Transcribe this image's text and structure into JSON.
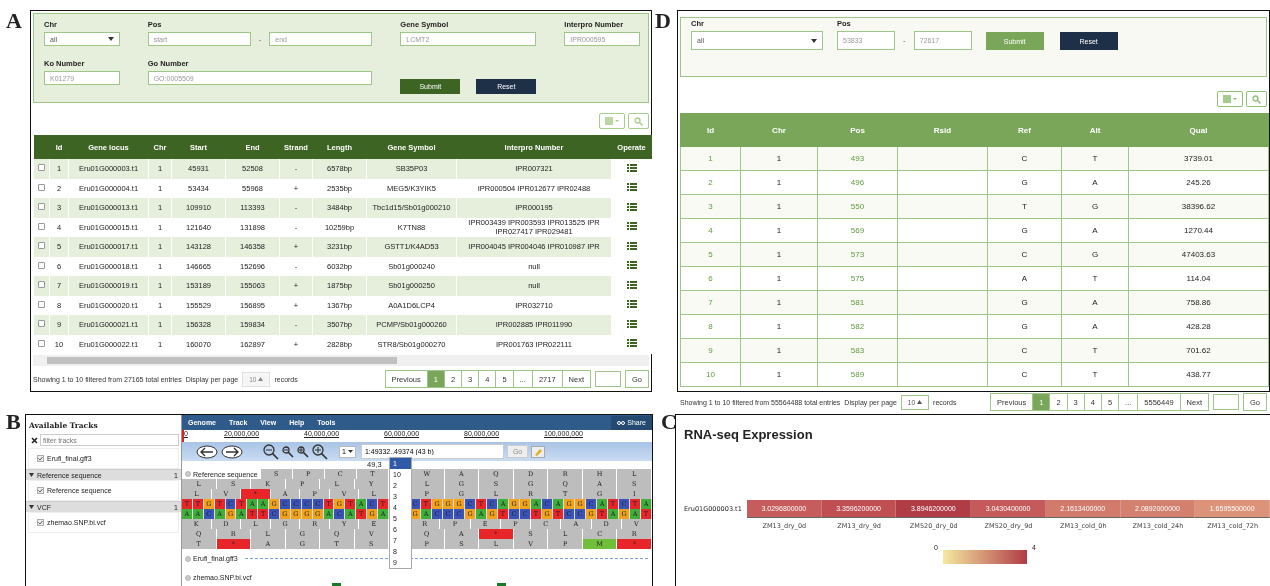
{
  "panel_a": {
    "letter": "A",
    "filters": [
      {
        "label": "Chr",
        "kind": "select",
        "value": "all"
      },
      {
        "label": "Pos",
        "kind": "range",
        "placeholder": "start",
        "placeholder_end": "end",
        "separator": "-"
      },
      {
        "label": "Gene Symbol",
        "kind": "text",
        "placeholder": "LCMT2"
      },
      {
        "label": "Interpro Number",
        "kind": "text",
        "placeholder": "IPR000595"
      },
      {
        "label": "Ko Number",
        "kind": "text",
        "placeholder": "K01279"
      },
      {
        "label": "Go Number",
        "kind": "text",
        "placeholder": "GO:0005509"
      }
    ],
    "submit": "Submit",
    "reset": "Reset",
    "columns": [
      "Id",
      "Gene locus",
      "Chr",
      "Start",
      "End",
      "Strand",
      "Length",
      "Gene Symbol",
      "Interpro Number",
      "Operate"
    ],
    "rows": [
      {
        "checked": false,
        "cells": [
          "1",
          "Eru01G000003.t1",
          "1",
          "45931",
          "52508",
          "-",
          "6578bp",
          "SB35P03",
          "IPR007321"
        ]
      },
      {
        "checked": false,
        "cells": [
          "2",
          "Eru01G000004.t1",
          "1",
          "53434",
          "55968",
          "+",
          "2535bp",
          "MEG5/K3YIK5",
          "IPR000504 IPR012677 IPR02488"
        ]
      },
      {
        "checked": false,
        "cells": [
          "3",
          "Eru01G000013.t1",
          "1",
          "109910",
          "113393",
          "-",
          "3484bp",
          "Tbc1d15/Sb01g000210",
          "IPR000195"
        ]
      },
      {
        "checked": false,
        "cells": [
          "4",
          "Eru01G000015.t1",
          "1",
          "121640",
          "131898",
          "-",
          "10259bp",
          "K7TN88",
          "IPR003439 IPR003593 IPR013525 IPR\nIPR027417 IPR029481"
        ]
      },
      {
        "checked": false,
        "cells": [
          "5",
          "Eru01G000017.t1",
          "1",
          "143128",
          "146358",
          "+",
          "3231bp",
          "GSTT1/K4AD53",
          "IPR004045 IPR004046 IPR010987 IPR"
        ]
      },
      {
        "checked": false,
        "cells": [
          "6",
          "Eru01G000018.t1",
          "1",
          "146665",
          "152696",
          "-",
          "6032bp",
          "Sb01g000240",
          "null"
        ]
      },
      {
        "checked": false,
        "cells": [
          "7",
          "Eru01G000019.t1",
          "1",
          "153189",
          "155063",
          "+",
          "1875bp",
          "Sb01g000250",
          "null"
        ]
      },
      {
        "checked": false,
        "cells": [
          "8",
          "Eru01G000020.t1",
          "1",
          "155529",
          "156895",
          "+",
          "1367bp",
          "A0A1D6LCP4",
          "IPR032710"
        ]
      },
      {
        "checked": false,
        "cells": [
          "9",
          "Eru01G000021.t1",
          "1",
          "156328",
          "159834",
          "-",
          "3507bp",
          "PCMP/Sb01g000260",
          "IPR002885 IPR011990"
        ]
      },
      {
        "checked": false,
        "cells": [
          "10",
          "Eru01G000022.t1",
          "1",
          "160070",
          "162897",
          "+",
          "2828bp",
          "STR8/Sb01g000270",
          "IPR001763 IPR022111"
        ]
      }
    ],
    "summary": "Showing 1 to 10 filtered from 27165 total entries",
    "per_page_label": "Display per page",
    "per_page": {
      "value": "10",
      "disabled": true
    },
    "records": "records",
    "previous": "Previous",
    "next": "Next",
    "go": "Go",
    "pages": [
      {
        "label": "1",
        "selected": true
      },
      {
        "label": "2",
        "selected": false
      },
      {
        "label": "3",
        "selected": false
      },
      {
        "label": "4",
        "selected": false
      },
      {
        "label": "5",
        "selected": false
      },
      {
        "label": "...",
        "selected": false
      },
      {
        "label": "2717",
        "selected": false
      }
    ]
  },
  "panel_d": {
    "letter": "D",
    "chr_label": "Chr",
    "chr_value": "all",
    "pos_label": "Pos",
    "placeholder_start": "53833",
    "placeholder_end": "72617",
    "separator": "-",
    "submit": "Submit",
    "reset": "Reset",
    "columns": [
      {
        "label": "Id",
        "link": true
      },
      {
        "label": "Chr"
      },
      {
        "label": "Pos",
        "link": true
      },
      {
        "label": "Rsid"
      },
      {
        "label": "Ref"
      },
      {
        "label": "Alt"
      },
      {
        "label": "Qual"
      }
    ],
    "rows": [
      [
        "1",
        "1",
        "493",
        "",
        "C",
        "T",
        "3739.01"
      ],
      [
        "2",
        "1",
        "496",
        "",
        "G",
        "A",
        "245.26"
      ],
      [
        "3",
        "1",
        "550",
        "",
        "T",
        "G",
        "38396.62"
      ],
      [
        "4",
        "1",
        "569",
        "",
        "G",
        "A",
        "1270.44"
      ],
      [
        "5",
        "1",
        "573",
        "",
        "C",
        "G",
        "47403.63"
      ],
      [
        "6",
        "1",
        "575",
        "",
        "A",
        "T",
        "114.04"
      ],
      [
        "7",
        "1",
        "581",
        "",
        "G",
        "A",
        "758.86"
      ],
      [
        "8",
        "1",
        "582",
        "",
        "G",
        "A",
        "428.28"
      ],
      [
        "9",
        "1",
        "583",
        "",
        "C",
        "T",
        "701.62"
      ],
      [
        "10",
        "1",
        "589",
        "",
        "C",
        "T",
        "438.77"
      ]
    ],
    "summary": "Showing 1 to 10 filtered from 55564488 total entries",
    "per_page_label": "Display per page",
    "per_page": {
      "value": "10",
      "disabled": false
    },
    "records": "records",
    "previous": "Previous",
    "next": "Next",
    "go": "Go",
    "pages": [
      {
        "label": "1",
        "selected": true
      },
      {
        "label": "2",
        "selected": false
      },
      {
        "label": "3",
        "selected": false
      },
      {
        "label": "4",
        "selected": false
      },
      {
        "label": "5",
        "selected": false
      },
      {
        "label": "...",
        "selected": false
      },
      {
        "label": "5556449",
        "selected": false
      }
    ]
  },
  "panel_b": {
    "letter": "B",
    "tracks_title": "Available Tracks",
    "filter": {
      "placeholder": "filter tracks"
    },
    "track_sections": [
      {
        "items": [
          {
            "label": "Erufi_final.gff3",
            "checked": true
          }
        ]
      },
      {
        "title": "Reference sequence",
        "count": "1",
        "expanded": true,
        "items": [
          {
            "label": "Reference sequence",
            "checked": true
          }
        ]
      },
      {
        "title": "VCF",
        "count": "1",
        "expanded": true,
        "items": [
          {
            "label": "zhemao.SNP.bi.vcf",
            "checked": true
          }
        ]
      }
    ],
    "menu": [
      "Genome",
      "Track",
      "View",
      "Help",
      "Tools"
    ],
    "share": "Share",
    "ruler": [
      "0",
      "20,000,000",
      "40,000,000",
      "60,000,000",
      "80,000,000",
      "100,000,000"
    ],
    "ref_select": "1",
    "location": "1:49332..49374 (43 b)",
    "go": "Go",
    "position_hint": "49,3",
    "dropdown": [
      {
        "label": "1",
        "selected": true
      },
      {
        "label": "10",
        "selected": false
      },
      {
        "label": "2",
        "selected": false
      },
      {
        "label": "3",
        "selected": false
      },
      {
        "label": "4",
        "selected": false
      },
      {
        "label": "5",
        "selected": false
      },
      {
        "label": "6",
        "selected": false
      },
      {
        "label": "7",
        "selected": false
      },
      {
        "label": "8",
        "selected": false
      },
      {
        "label": "9",
        "selected": false
      }
    ],
    "sequence": {
      "label": "Reference sequence",
      "rows": [
        {
          "kind": "frame",
          "left": [
            "S",
            "P",
            "C",
            "T"
          ],
          "right": [
            "W",
            "A",
            "Q",
            "D",
            "R",
            "H",
            "L"
          ]
        },
        {
          "kind": "frame",
          "left": [
            "L",
            "S",
            "K",
            "P",
            "L",
            "Y"
          ],
          "right": [
            "L",
            "G",
            "S",
            "G",
            "Q",
            "A",
            "S"
          ]
        },
        {
          "kind": "frame",
          "left": [
            "L",
            "V",
            {
              "b": "*",
              "color": "#e8262a"
            },
            "A",
            "P",
            "V",
            "L"
          ],
          "right": [
            "P",
            "G",
            "L",
            "R",
            "T",
            "G",
            "I"
          ]
        },
        {
          "kind": "bases",
          "left": [
            {
              "b": "T",
              "color": "#e8262a"
            },
            {
              "b": "T",
              "color": "#e8262a"
            },
            {
              "b": "G",
              "color": "#f2a31b"
            },
            {
              "b": "T",
              "color": "#e8262a"
            },
            {
              "b": "C",
              "color": "#3a53b8"
            },
            {
              "b": "T",
              "color": "#e8262a"
            },
            {
              "b": "A",
              "color": "#3fae3a"
            },
            {
              "b": "A",
              "color": "#3fae3a"
            },
            {
              "b": "G",
              "color": "#f2a31b"
            },
            {
              "b": "C",
              "color": "#3a53b8"
            },
            {
              "b": "C",
              "color": "#3a53b8"
            },
            {
              "b": "C",
              "color": "#3a53b8"
            },
            {
              "b": "C",
              "color": "#3a53b8"
            },
            {
              "b": "T",
              "color": "#e8262a"
            },
            {
              "b": "G",
              "color": "#f2a31b"
            },
            {
              "b": "T",
              "color": "#e8262a"
            },
            {
              "b": "A",
              "color": "#3fae3a"
            },
            {
              "b": "C",
              "color": "#3a53b8"
            },
            {
              "b": "T",
              "color": "#e8262a"
            }
          ],
          "right": [
            {
              "b": "C",
              "color": "#3a53b8"
            },
            {
              "b": "T",
              "color": "#e8262a"
            },
            {
              "b": "G",
              "color": "#f2a31b"
            },
            {
              "b": "G",
              "color": "#f2a31b"
            },
            {
              "b": "G",
              "color": "#f2a31b"
            },
            {
              "b": "C",
              "color": "#3a53b8"
            },
            {
              "b": "T",
              "color": "#e8262a"
            },
            {
              "b": "C",
              "color": "#3a53b8"
            },
            {
              "b": "A",
              "color": "#3fae3a"
            },
            {
              "b": "G",
              "color": "#f2a31b"
            },
            {
              "b": "G",
              "color": "#f2a31b"
            },
            {
              "b": "A",
              "color": "#3fae3a"
            },
            {
              "b": "C",
              "color": "#3a53b8"
            },
            {
              "b": "A",
              "color": "#3fae3a"
            },
            {
              "b": "G",
              "color": "#f2a31b"
            },
            {
              "b": "G",
              "color": "#f2a31b"
            },
            {
              "b": "C",
              "color": "#3a53b8"
            },
            {
              "b": "A",
              "color": "#3fae3a"
            },
            {
              "b": "T",
              "color": "#e8262a"
            },
            {
              "b": "C",
              "color": "#3a53b8"
            },
            {
              "b": "T",
              "color": "#e8262a"
            },
            {
              "b": "A",
              "color": "#3fae3a"
            }
          ]
        },
        {
          "kind": "bases",
          "left": [
            {
              "b": "A",
              "color": "#3fae3a"
            },
            {
              "b": "A",
              "color": "#3fae3a"
            },
            {
              "b": "C",
              "color": "#3a53b8"
            },
            {
              "b": "A",
              "color": "#3fae3a"
            },
            {
              "b": "G",
              "color": "#f2a31b"
            },
            {
              "b": "A",
              "color": "#3fae3a"
            },
            {
              "b": "T",
              "color": "#e8262a"
            },
            {
              "b": "T",
              "color": "#e8262a"
            },
            {
              "b": "C",
              "color": "#3a53b8"
            },
            {
              "b": "G",
              "color": "#f2a31b"
            },
            {
              "b": "G",
              "color": "#f2a31b"
            },
            {
              "b": "G",
              "color": "#f2a31b"
            },
            {
              "b": "G",
              "color": "#f2a31b"
            },
            {
              "b": "A",
              "color": "#3fae3a"
            },
            {
              "b": "C",
              "color": "#3a53b8"
            },
            {
              "b": "A",
              "color": "#3fae3a"
            },
            {
              "b": "T",
              "color": "#e8262a"
            },
            {
              "b": "G",
              "color": "#f2a31b"
            },
            {
              "b": "A",
              "color": "#3fae3a"
            }
          ],
          "right": [
            {
              "b": "G",
              "color": "#f2a31b"
            },
            {
              "b": "A",
              "color": "#3fae3a"
            },
            {
              "b": "C",
              "color": "#3a53b8"
            },
            {
              "b": "C",
              "color": "#3a53b8"
            },
            {
              "b": "C",
              "color": "#3a53b8"
            },
            {
              "b": "G",
              "color": "#f2a31b"
            },
            {
              "b": "A",
              "color": "#3fae3a"
            },
            {
              "b": "G",
              "color": "#f2a31b"
            },
            {
              "b": "T",
              "color": "#e8262a"
            },
            {
              "b": "C",
              "color": "#3a53b8"
            },
            {
              "b": "C",
              "color": "#3a53b8"
            },
            {
              "b": "T",
              "color": "#e8262a"
            },
            {
              "b": "G",
              "color": "#f2a31b"
            },
            {
              "b": "T",
              "color": "#e8262a"
            },
            {
              "b": "C",
              "color": "#3a53b8"
            },
            {
              "b": "C",
              "color": "#3a53b8"
            },
            {
              "b": "G",
              "color": "#f2a31b"
            },
            {
              "b": "T",
              "color": "#e8262a"
            },
            {
              "b": "A",
              "color": "#3fae3a"
            },
            {
              "b": "G",
              "color": "#f2a31b"
            },
            {
              "b": "A",
              "color": "#3fae3a"
            },
            {
              "b": "T",
              "color": "#e8262a"
            }
          ]
        },
        {
          "kind": "frame",
          "left": [
            "K",
            "D",
            "L",
            "G",
            "R",
            "Y",
            "E"
          ],
          "right": [
            "R",
            "P",
            "E",
            "P",
            "C",
            "A",
            "D",
            "V"
          ]
        },
        {
          "kind": "frame",
          "left": [
            "Q",
            "R",
            "L",
            "G",
            "Q",
            "V"
          ],
          "right": [
            "Q",
            "A",
            {
              "b": "*",
              "color": "#e8262a"
            },
            "S",
            "L",
            "C",
            "R"
          ]
        },
        {
          "kind": "frame",
          "left": [
            "T",
            {
              "b": "*",
              "color": "#e8262a"
            },
            "A",
            "G",
            "T",
            "S"
          ],
          "right": [
            "P",
            "S",
            "L",
            "V",
            "P",
            {
              "b": "M",
              "color": "#6fbf3a"
            },
            {
              "b": "*",
              "color": "#e8262a"
            }
          ]
        }
      ]
    },
    "feature_tracks": [
      "Erufi_final.gff3",
      "zhemao.SNP.bi.vcf"
    ]
  },
  "panel_c": {
    "letter": "C",
    "title": "RNA-seq Expression",
    "gene": "Eru01G000003.t1",
    "cells": [
      {
        "label": "ZM13_dry_0d",
        "value": "3.0296800000",
        "color": "#c65c5c"
      },
      {
        "label": "ZM13_dry_9d",
        "value": "3.3596200000",
        "color": "#bf4f53"
      },
      {
        "label": "ZM520_dry_0d",
        "value": "3.8946200000",
        "color": "#b03c46"
      },
      {
        "label": "ZM520_dry_9d",
        "value": "3.0430400000",
        "color": "#c55a5a"
      },
      {
        "label": "ZM13_cold_0h",
        "value": "2.1613400000",
        "color": "#d27b6d"
      },
      {
        "label": "ZM13_cold_24h",
        "value": "2.0892000000",
        "color": "#d4806f"
      },
      {
        "label": "ZM13_cold_72h",
        "value": "1.6595500000",
        "color": "#dc937a"
      }
    ],
    "legend": {
      "min": "0",
      "max": "4"
    }
  }
}
